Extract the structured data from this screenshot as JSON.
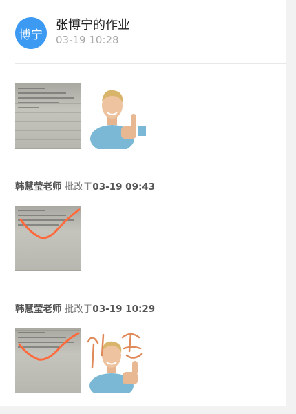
{
  "homework": {
    "avatar_text": "博宁",
    "title": "张博宁的作业",
    "submitted_time": "03-19 10:28"
  },
  "reviews": [
    {
      "teacher": "韩慧莹老师",
      "verb": "批改于",
      "time": "03-19 09:43"
    },
    {
      "teacher": "韩慧莹老师",
      "verb": "批改于",
      "time": "03-19 10:29"
    }
  ],
  "colors": {
    "avatar_bg": "#3d9af2",
    "check_mark": "#ff6a3d"
  }
}
